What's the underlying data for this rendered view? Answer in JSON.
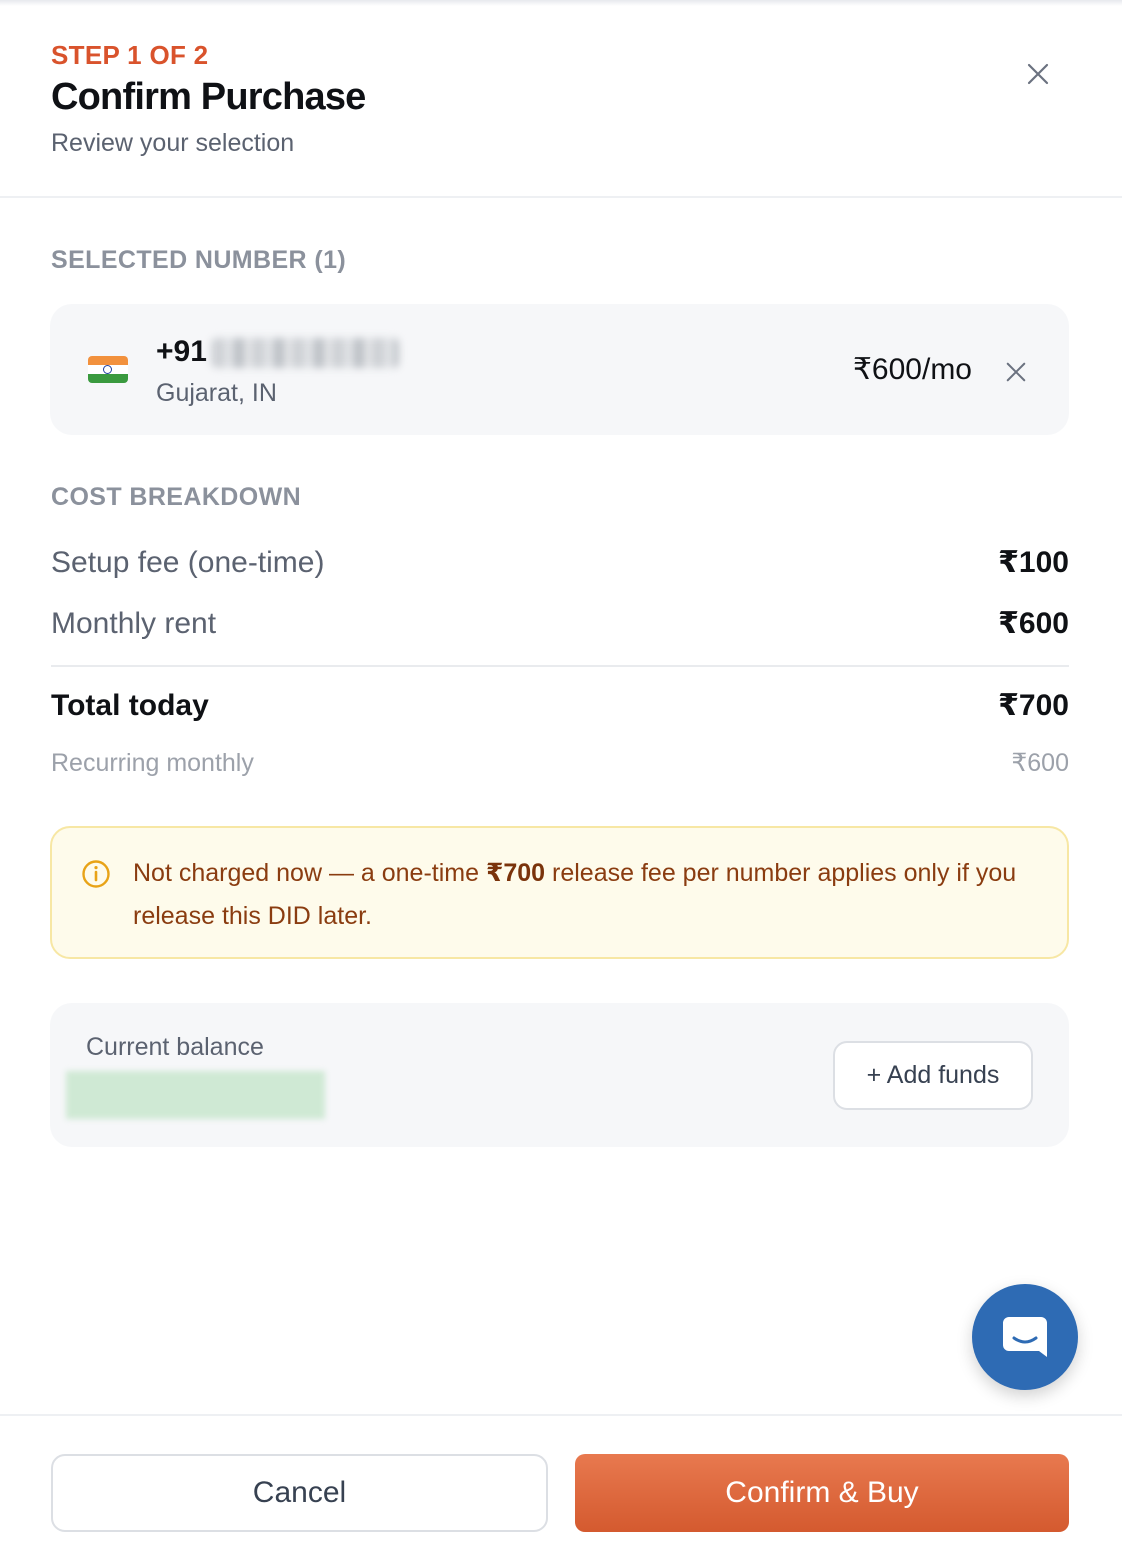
{
  "header": {
    "step": "STEP 1 OF 2",
    "title": "Confirm Purchase",
    "subtitle": "Review your selection",
    "close_icon": "close-icon"
  },
  "selected": {
    "section_label": "SELECTED NUMBER (1)",
    "number_prefix": "+91",
    "region": "Gujarat, IN",
    "price": "₹600/mo",
    "flag_icon": "india-flag-icon",
    "remove_icon": "close-icon"
  },
  "cost": {
    "section_label": "COST BREAKDOWN",
    "rows": [
      {
        "label": "Setup fee (one-time)",
        "value": "₹100"
      },
      {
        "label": "Monthly rent",
        "value": "₹600"
      }
    ],
    "total": {
      "label": "Total today",
      "value": "₹700"
    },
    "recurring": {
      "label": "Recurring monthly",
      "value": "₹600"
    }
  },
  "notice": {
    "text_before": "Not charged now — a one-time ",
    "amount": "₹700",
    "text_after": " release fee per number applies only if you release this DID later.",
    "icon": "info-icon"
  },
  "balance": {
    "label": "Current balance",
    "add_funds_label": "+ Add funds"
  },
  "chat": {
    "icon": "chat-icon"
  },
  "footer": {
    "cancel_label": "Cancel",
    "confirm_label": "Confirm & Buy"
  },
  "colors": {
    "accent": "#d9532c",
    "confirm_gradient_top": "#e8794f",
    "confirm_gradient_bottom": "#d45a2f",
    "notice_bg": "#fefbeb",
    "notice_text": "#8a3c10",
    "chat_blue": "#2e6bb4"
  }
}
